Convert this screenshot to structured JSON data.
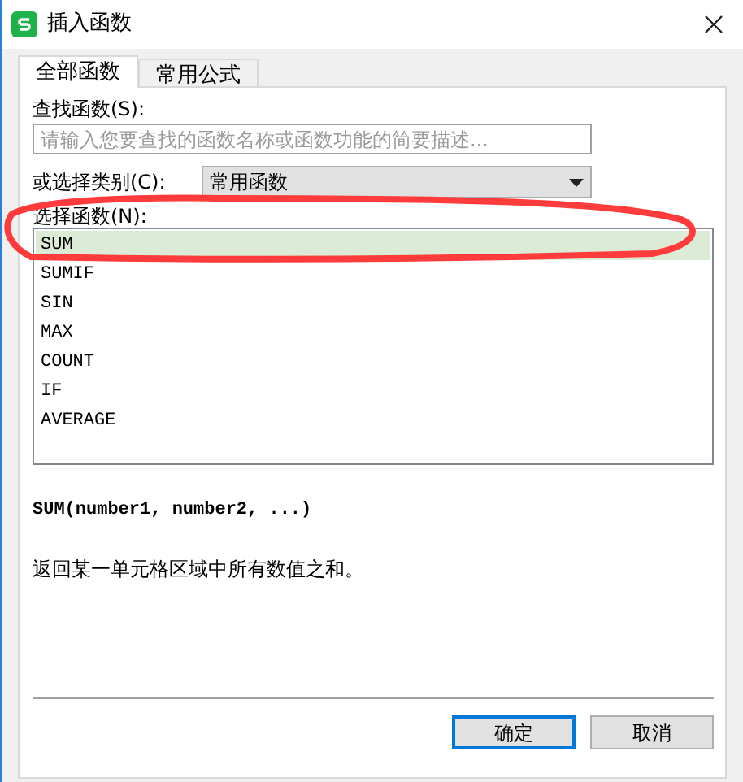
{
  "window": {
    "title": "插入函数"
  },
  "tabs": [
    {
      "label": "全部函数",
      "selected": true
    },
    {
      "label": "常用公式",
      "selected": false
    }
  ],
  "search": {
    "label": "查找函数(S):",
    "placeholder": "请输入您要查找的函数名称或函数功能的简要描述..."
  },
  "category": {
    "label": "或选择类别(C):",
    "value": "常用函数"
  },
  "functions": {
    "label": "选择函数(N):",
    "items": [
      {
        "name": "SUM",
        "selected": true
      },
      {
        "name": "SUMIF",
        "selected": false
      },
      {
        "name": "SIN",
        "selected": false
      },
      {
        "name": "MAX",
        "selected": false
      },
      {
        "name": "COUNT",
        "selected": false
      },
      {
        "name": "IF",
        "selected": false
      },
      {
        "name": "AVERAGE",
        "selected": false
      }
    ]
  },
  "signature": "SUM(number1, number2, ...)",
  "description": "返回某一单元格区域中所有数值之和。",
  "buttons": [
    {
      "label": "确定",
      "default": true
    },
    {
      "label": "取消",
      "default": false
    }
  ]
}
